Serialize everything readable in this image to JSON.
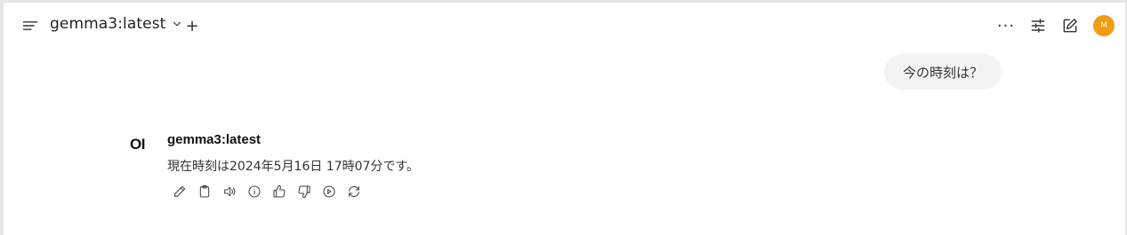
{
  "header": {
    "model_name": "gemma3:latest",
    "add_label": "+",
    "more_label": "···",
    "avatar_initial": "M"
  },
  "conversation": {
    "user_message": "今の時刻は？",
    "assistant": {
      "logo_text": "OI",
      "name": "gemma3:latest",
      "message": "現在時刻は2024年5月16日 17時07分です。"
    }
  },
  "message_actions": [
    "edit-icon",
    "copy-icon",
    "speaker-icon",
    "info-icon",
    "thumbs-up-icon",
    "thumbs-down-icon",
    "play-icon",
    "regenerate-icon"
  ],
  "colors": {
    "avatar": "#f39c12",
    "user_bubble": "#f3f3f3"
  }
}
